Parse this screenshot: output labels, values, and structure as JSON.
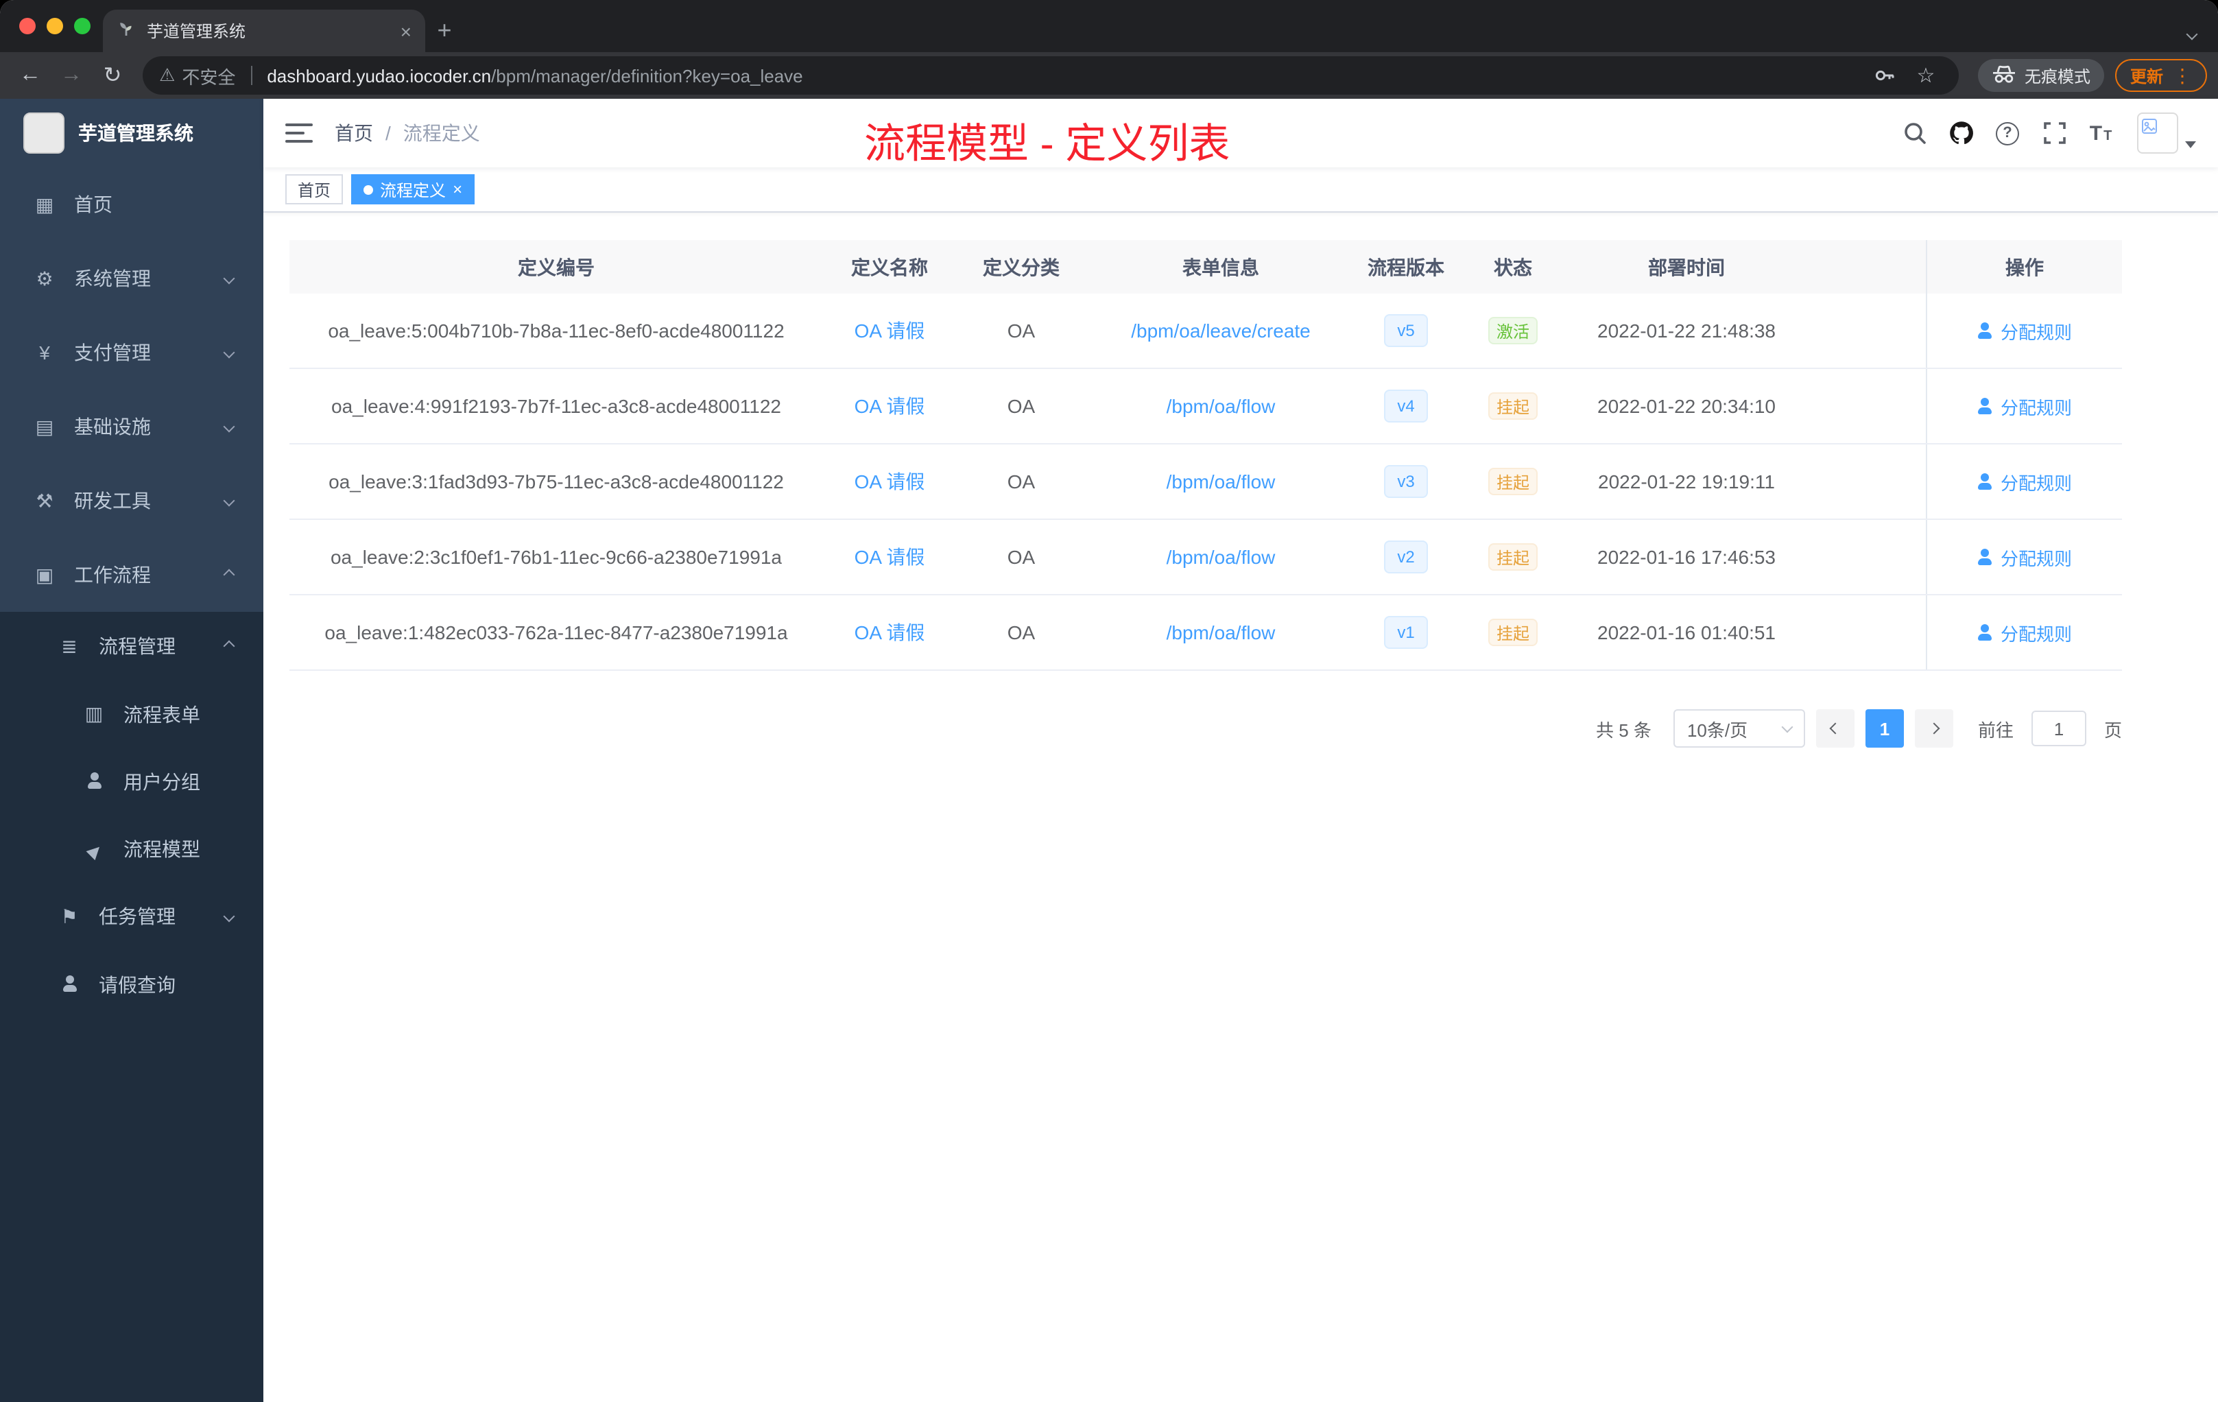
{
  "glyphs": {
    "back": "←",
    "forward": "→",
    "reload": "↻",
    "star": "☆",
    "warning": "⚠",
    "kebab": "⋮",
    "plus": "+",
    "close": "×",
    "font_big": "T",
    "font_small": "T"
  },
  "browser": {
    "tab_title": "芋道管理系统",
    "security_label": "不安全",
    "url_domain": "dashboard.yudao.iocoder.cn",
    "url_path": "/bpm/manager/definition?key=oa_leave",
    "incognito_label": "无痕模式",
    "update_label": "更新"
  },
  "sidebar": {
    "brand": "芋道管理系统",
    "items": [
      {
        "label": "首页",
        "glyph": "▦"
      },
      {
        "label": "系统管理",
        "glyph": "⚙"
      },
      {
        "label": "支付管理",
        "glyph": "¥"
      },
      {
        "label": "基础设施",
        "glyph": "▤"
      },
      {
        "label": "研发工具",
        "glyph": "⚒"
      },
      {
        "label": "工作流程",
        "glyph": "▣"
      },
      {
        "label": "流程管理",
        "glyph": "≣"
      },
      {
        "label": "流程表单",
        "glyph": "▥"
      },
      {
        "label": "用户分组"
      },
      {
        "label": "流程模型",
        "glyph": "▶"
      },
      {
        "label": "任务管理",
        "glyph": "⚑"
      },
      {
        "label": "请假查询"
      }
    ]
  },
  "header": {
    "breadcrumb_home": "首页",
    "breadcrumb_sep": "/",
    "breadcrumb_current": "流程定义",
    "annotation": "流程模型 - 定义列表"
  },
  "tags": {
    "home": "首页",
    "active": "流程定义"
  },
  "table": {
    "columns": [
      "定义编号",
      "定义名称",
      "定义分类",
      "表单信息",
      "流程版本",
      "状态",
      "部署时间",
      "操作"
    ],
    "action_label": "分配规则",
    "rows": [
      {
        "id": "oa_leave:5:004b710b-7b8a-11ec-8ef0-acde48001122",
        "name": "OA 请假",
        "category": "OA",
        "form": "/bpm/oa/leave/create",
        "version": "v5",
        "status": "激活",
        "time": "2022-01-22 21:48:38"
      },
      {
        "id": "oa_leave:4:991f2193-7b7f-11ec-a3c8-acde48001122",
        "name": "OA 请假",
        "category": "OA",
        "form": "/bpm/oa/flow",
        "version": "v4",
        "status": "挂起",
        "time": "2022-01-22 20:34:10"
      },
      {
        "id": "oa_leave:3:1fad3d93-7b75-11ec-a3c8-acde48001122",
        "name": "OA 请假",
        "category": "OA",
        "form": "/bpm/oa/flow",
        "version": "v3",
        "status": "挂起",
        "time": "2022-01-22 19:19:11"
      },
      {
        "id": "oa_leave:2:3c1f0ef1-76b1-11ec-9c66-a2380e71991a",
        "name": "OA 请假",
        "category": "OA",
        "form": "/bpm/oa/flow",
        "version": "v2",
        "status": "挂起",
        "time": "2022-01-16 17:46:53"
      },
      {
        "id": "oa_leave:1:482ec033-762a-11ec-8477-a2380e71991a",
        "name": "OA 请假",
        "category": "OA",
        "form": "/bpm/oa/flow",
        "version": "v1",
        "status": "挂起",
        "time": "2022-01-16 01:40:51"
      }
    ]
  },
  "pagination": {
    "total_label": "共 5 条",
    "page_size": "10条/页",
    "current_page": "1",
    "goto_label": "前往",
    "goto_value": "1",
    "unit_label": "页"
  },
  "colors": {
    "accent": "#409eff",
    "status_active": "#67c23a",
    "status_suspended": "#e6a23c",
    "annotation_red": "#f5222d",
    "sidebar_bg": "#304156",
    "submenu_bg": "#1f2d3d"
  }
}
